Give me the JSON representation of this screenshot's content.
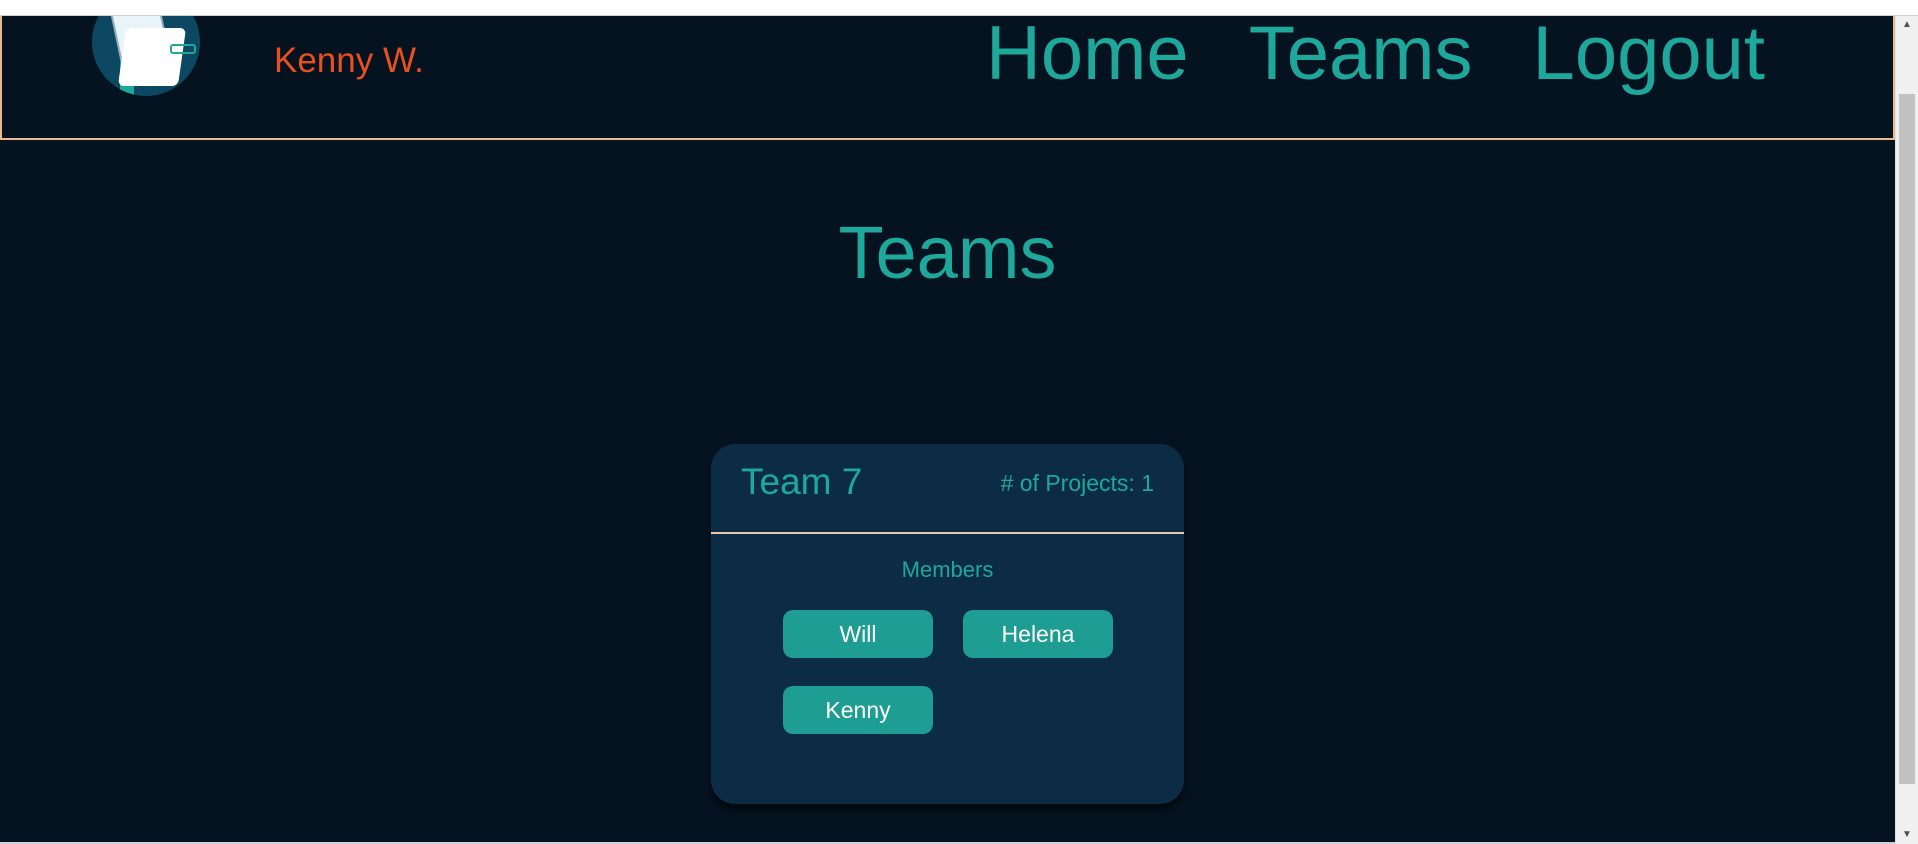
{
  "header": {
    "user_name": "Kenny W.",
    "nav": {
      "home": "Home",
      "teams": "Teams",
      "logout": "Logout"
    }
  },
  "main": {
    "title": "Teams",
    "team_card": {
      "team_name": "Team 7",
      "projects_label": "# of Projects: 1",
      "members_label": "Members",
      "members": [
        "Will",
        "Helena",
        "Kenny"
      ]
    }
  },
  "colors": {
    "background": "#04131f",
    "accent": "#1ea89c",
    "user_name": "#e8501e",
    "card": "#0c2c45",
    "border": "#e8b98a"
  },
  "icons": {
    "logo": "folder-document-logo-icon",
    "scroll_up": "scroll-up-arrow-icon",
    "scroll_down": "scroll-down-arrow-icon"
  }
}
